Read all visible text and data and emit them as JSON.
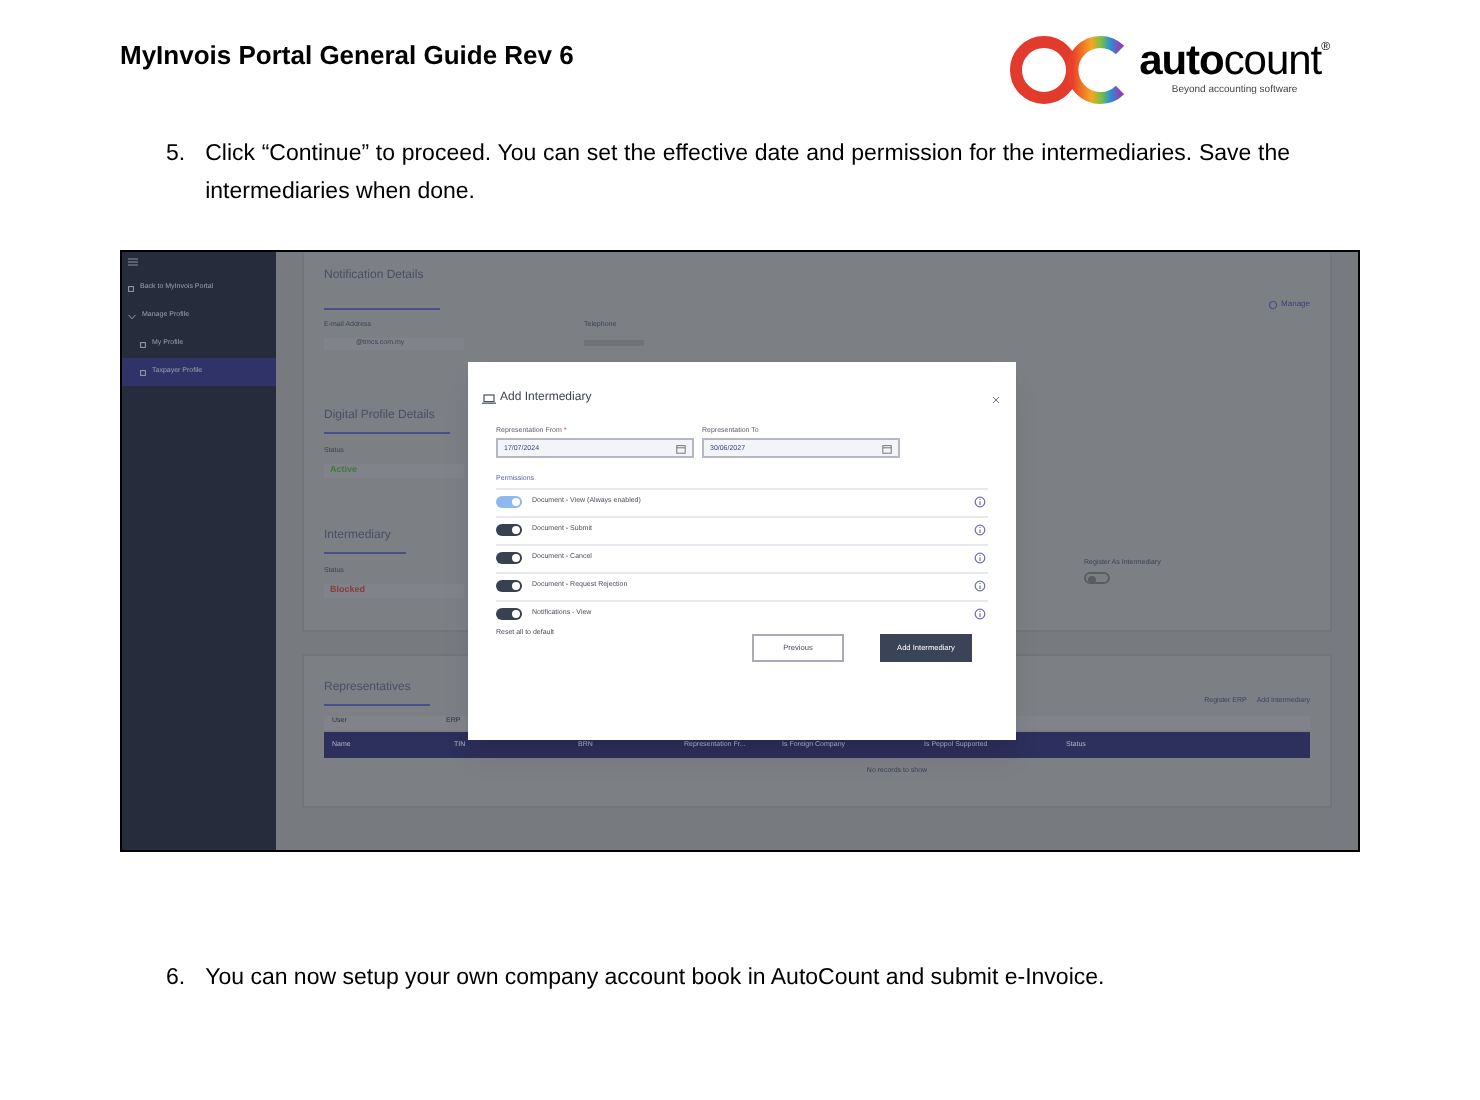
{
  "header": {
    "title": "MyInvois Portal General Guide Rev 6",
    "logo": {
      "brand": "**auto**count",
      "registered": "®",
      "tagline": "Beyond accounting software"
    }
  },
  "steps": [
    {
      "number": "5.",
      "text": "Click “Continue” to proceed. You can set the effective date and permission for the intermediaries. Save the intermediaries when done."
    }
  ],
  "screenshot": {
    "sidebar": {
      "items": [
        {
          "label": "Back to MyInvois Portal",
          "selected": false
        },
        {
          "label": "Manage Profile",
          "selected": false,
          "expanded": true,
          "children": [
            {
              "label": "My Profile",
              "selected": false
            },
            {
              "label": "Taxpayer Profile",
              "selected": true
            }
          ]
        }
      ]
    },
    "notification": {
      "heading": "Notification Details",
      "manage": "Manage",
      "email_label": "E-mail Address",
      "email_value": "@tmcs.com.my",
      "telephone_label": "Telephone"
    },
    "sections": [
      {
        "heading": "Digital Profile Details",
        "status_label": "Status",
        "status": "Active",
        "color": "#3f7a3f"
      },
      {
        "heading": "Intermediary",
        "status_label": "Status",
        "status": "Blocked",
        "color": "#8a3b3b"
      }
    ],
    "register": {
      "label": "Register As Intermediary",
      "on": false
    },
    "representatives": {
      "heading": "Representatives",
      "tabs": [
        "User",
        "ERP"
      ],
      "actions": [
        "Register ERP",
        "Add Intermediary"
      ],
      "columns": [
        "Name",
        "TIN",
        "BRN",
        "Representation Fr...",
        "Is Foreign Company",
        "Is Peppol Supported",
        "Status"
      ],
      "empty": "No records to show"
    },
    "modal": {
      "title": "Add Intermediary",
      "fields": [
        {
          "label": "Representation From",
          "required_mark": "*",
          "value": "17/07/2024"
        },
        {
          "label": "Representation To",
          "value": "30/06/2027"
        }
      ],
      "permissions_label": "Permissions",
      "permissions": [
        {
          "label": "Document - View (Always enabled)",
          "on": true,
          "disabled": true
        },
        {
          "label": "Document - Submit",
          "on": true,
          "disabled": false
        },
        {
          "label": "Document - Cancel",
          "on": true,
          "disabled": false
        },
        {
          "label": "Document - Request Rejection",
          "on": true,
          "disabled": false
        },
        {
          "label": "Notifications - View",
          "on": true,
          "disabled": false
        }
      ],
      "reset": "Reset all to default",
      "buttons": [
        {
          "label": "Previous",
          "kind": "secondary"
        },
        {
          "label": "Add Intermediary",
          "kind": "primary"
        }
      ]
    }
  },
  "steps_after": [
    {
      "number": "6.",
      "text": "You can now setup your own company account book in AutoCount and submit e-Invoice."
    }
  ]
}
